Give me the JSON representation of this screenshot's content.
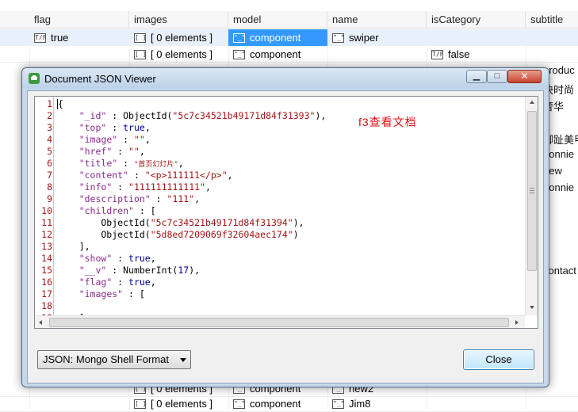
{
  "grid": {
    "columns": [
      "flag",
      "images",
      "model",
      "name",
      "isCategory",
      "subtitle"
    ],
    "rows": [
      {
        "flag": "true",
        "images": "[ 0 elements ]",
        "model": "component",
        "name": "swiper",
        "isCategory": "",
        "subtitle": ""
      },
      {
        "flag": "",
        "images": "[ 0 elements ]",
        "model": "component",
        "name": "",
        "isCategory": "false",
        "subtitle": ""
      },
      {
        "flag": "",
        "images": "[ 0 elements ]",
        "model": "component",
        "name": "new2",
        "isCategory": "",
        "subtitle": ""
      },
      {
        "flag": "",
        "images": "[ 0 elements ]",
        "model": "component",
        "name": "Jim8",
        "isCategory": "",
        "subtitle": ""
      }
    ],
    "right_edge_texts": [
      "produc",
      "快时尚",
      "奢华",
      "脚趾美甲",
      "bonnie",
      "new",
      "bonnie",
      "contact"
    ]
  },
  "dialog": {
    "title": "Document JSON Viewer",
    "annotation": "f3查看文档",
    "format_selected": "JSON: Mongo Shell Format",
    "close_label": "Close",
    "line_numbers": [
      "1",
      "2",
      "3",
      "4",
      "5",
      "6",
      "7",
      "8",
      "9",
      "10",
      "11",
      "12",
      "13",
      "14",
      "15",
      "16",
      "17",
      "18",
      "19"
    ],
    "code": {
      "l1": "{",
      "id_key": "\"_id\"",
      "id_fn": "ObjectId(",
      "id_val": "\"5c7c34521b49171d84f31393\"",
      "top_key": "\"top\"",
      "top_val": "true",
      "image_key": "\"image\"",
      "image_val": "\"\"",
      "href_key": "\"href\"",
      "href_val": "\"\"",
      "title_key": "\"title\"",
      "title_val": "\"首页幻灯片\"",
      "content_key": "\"content\"",
      "content_val": "\"<p>111111</p>\"",
      "info_key": "\"info\"",
      "info_val": "\"111111111111\"",
      "description_key": "\"description\"",
      "description_val": "\"111\"",
      "children_key": "\"children\"",
      "child1": "\"5c7c34521b49171d84f31394\"",
      "child2": "\"5d8ed7209069f32604aec174\"",
      "show_key": "\"show\"",
      "show_val": "true",
      "v_key": "\"__v\"",
      "v_fn": "NumberInt(",
      "v_val": "17",
      "flag_key": "\"flag\"",
      "flag_val": "true",
      "images_key": "\"images\"",
      "l19": "]"
    }
  }
}
